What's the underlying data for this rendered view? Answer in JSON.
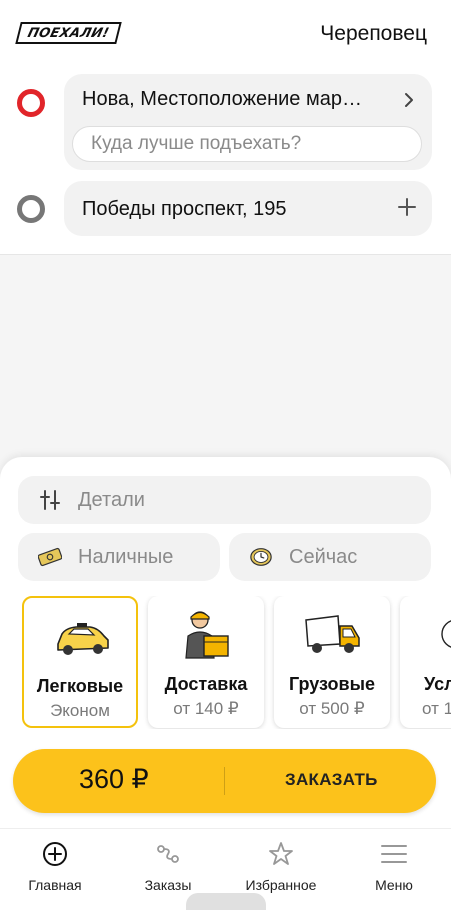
{
  "app": {
    "logo": "ПОЕХАЛИ!",
    "city": "Череповец"
  },
  "route": {
    "from": "Нова, Местоположение мар…",
    "entrance_placeholder": "Куда лучше подъехать?",
    "to": "Победы проспект, 195"
  },
  "options": {
    "details": "Детали",
    "payment": "Наличные",
    "time": "Сейчас"
  },
  "tariffs": [
    {
      "name": "Легковые",
      "sub": "Эконом",
      "icon": "car-icon",
      "selected": true
    },
    {
      "name": "Доставка",
      "sub": "от 140 ₽",
      "icon": "courier-icon"
    },
    {
      "name": "Грузовые",
      "sub": "от 500 ₽",
      "icon": "truck-icon"
    },
    {
      "name": "Усл",
      "sub": "от 1",
      "icon": "service-icon"
    }
  ],
  "order": {
    "price": "360 ₽",
    "label": "ЗАКАЗАТЬ"
  },
  "nav": [
    {
      "label": "Главная",
      "icon": "plus-circle-icon"
    },
    {
      "label": "Заказы",
      "icon": "route-icon"
    },
    {
      "label": "Избранное",
      "icon": "star-icon"
    },
    {
      "label": "Меню",
      "icon": "hamburger-icon"
    }
  ],
  "colors": {
    "accent": "#fcc21b",
    "from_marker": "#e1252a",
    "to_marker": "#777777",
    "selected_border": "#f4c20d"
  }
}
